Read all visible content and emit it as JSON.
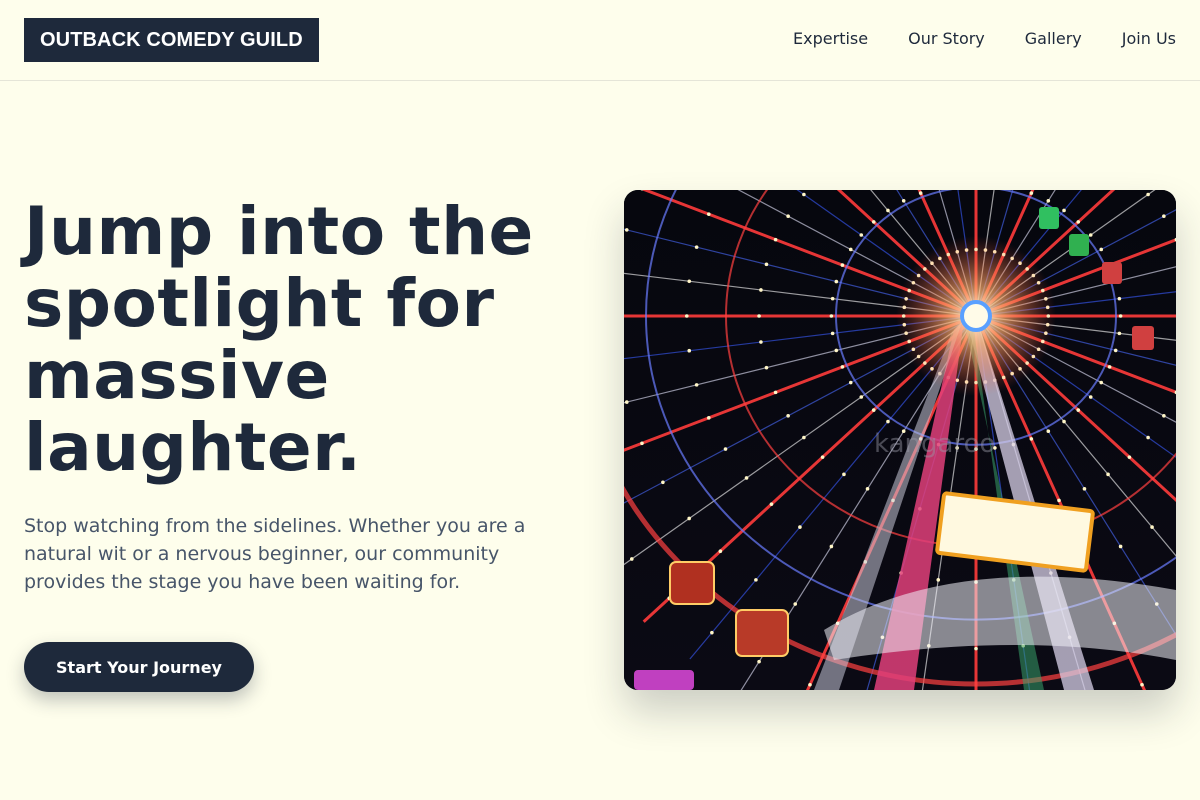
{
  "header": {
    "logo": "OUTBACK COMEDY GUILD",
    "nav": [
      {
        "label": "Expertise"
      },
      {
        "label": "Our Story"
      },
      {
        "label": "Gallery"
      },
      {
        "label": "Join Us"
      }
    ]
  },
  "hero": {
    "title": "Jump into the spotlight for massive laughter.",
    "subtitle": "Stop watching from the sidelines. Whether you are a natural wit or a nervous beginner, our community provides the stage you have been waiting for.",
    "cta_label": "Start Your Journey",
    "image": {
      "subject": "illuminated ferris wheel at night",
      "watermark": "kangaroo"
    }
  },
  "colors": {
    "background": "#fefeec",
    "primary": "#1e293b",
    "muted_text": "#475569"
  }
}
